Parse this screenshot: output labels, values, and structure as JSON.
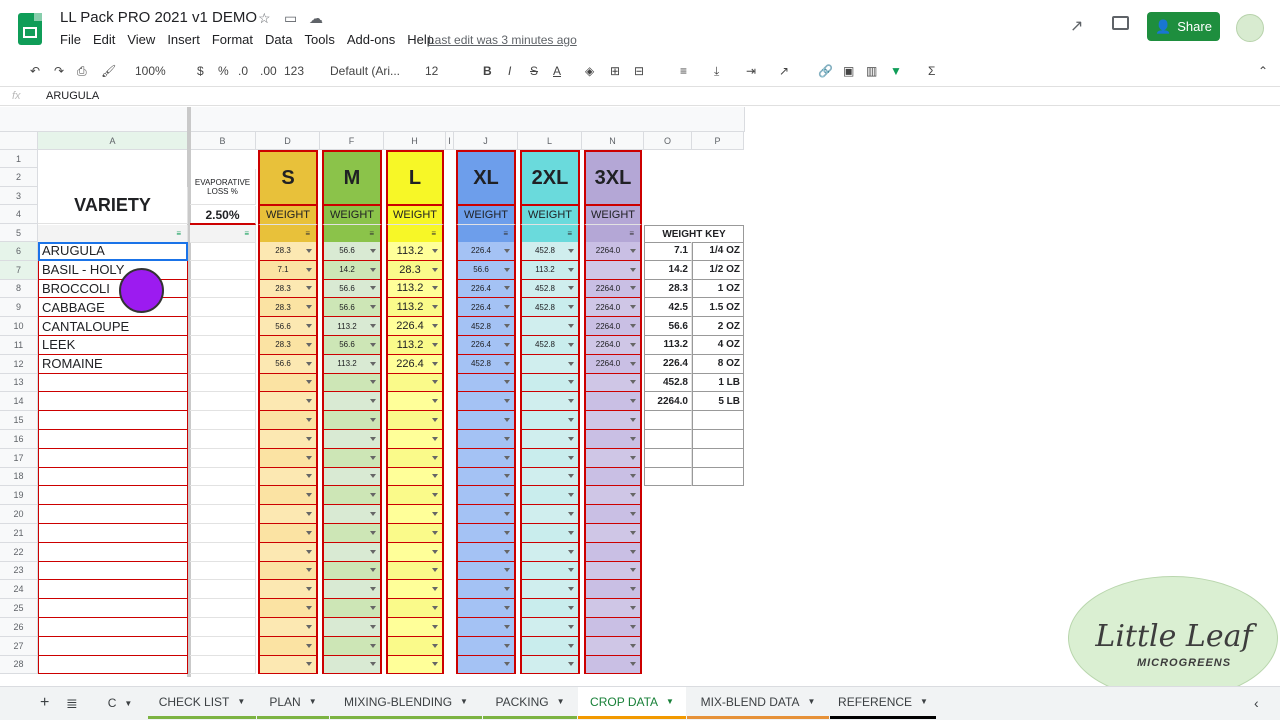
{
  "title": "LL Pack PRO 2021 v1 DEMO",
  "menu": [
    "File",
    "Edit",
    "View",
    "Insert",
    "Format",
    "Data",
    "Tools",
    "Add-ons",
    "Help"
  ],
  "last_edit": "Last edit was 3 minutes ago",
  "share": "Share",
  "toolbar": {
    "zoom": "100%",
    "currency": "$",
    "percent": "%",
    "dec_less": ".0",
    "dec_more": ".00",
    "number_format": "123",
    "font": "Default (Ari...",
    "size": "12"
  },
  "formula": {
    "fx": "fx",
    "ref": "ARUGULA"
  },
  "cols": [
    "A",
    "B",
    "D",
    "F",
    "H",
    "I",
    "J",
    "L",
    "N",
    "O",
    "P"
  ],
  "sizes": [
    {
      "label": "S",
      "sub": "WEIGHT",
      "color": "#e8c13a",
      "light": "#fbe3a3",
      "cell": "#fce8b2"
    },
    {
      "label": "M",
      "sub": "WEIGHT",
      "color": "#8bc34a",
      "light": "#cde6b6",
      "cell": "#d9ead3"
    },
    {
      "label": "L",
      "sub": "WEIGHT",
      "color": "#f7f727",
      "light": "#fafa8a",
      "cell": "#ffff99"
    },
    {
      "label": "XL",
      "sub": "WEIGHT",
      "color": "#6d9eeb",
      "light": "#a4c2f4",
      "cell": "#a4c2f4"
    },
    {
      "label": "2XL",
      "sub": "WEIGHT",
      "color": "#6adadc",
      "light": "#c9eded",
      "cell": "#d0eeee"
    },
    {
      "label": "3XL",
      "sub": "WEIGHT",
      "color": "#b4a7d6",
      "light": "#cfc6e6",
      "cell": "#c9bfe4"
    }
  ],
  "header": {
    "variety": "VARIETY",
    "evap": "EVAPORATIVE LOSS %",
    "evap_val": "2.50%"
  },
  "rows": [
    {
      "name": "ARUGULA",
      "v": [
        "28.3",
        "56.6",
        "113.2",
        "226.4",
        "452.8",
        "2264.0"
      ]
    },
    {
      "name": "BASIL - HOLY",
      "v": [
        "7.1",
        "14.2",
        "28.3",
        "56.6",
        "113.2",
        ""
      ]
    },
    {
      "name": "BROCCOLI",
      "v": [
        "28.3",
        "56.6",
        "113.2",
        "226.4",
        "452.8",
        "2264.0"
      ]
    },
    {
      "name": "CABBAGE",
      "v": [
        "28.3",
        "56.6",
        "113.2",
        "226.4",
        "452.8",
        "2264.0"
      ]
    },
    {
      "name": "CANTALOUPE",
      "v": [
        "56.6",
        "113.2",
        "226.4",
        "452.8",
        "",
        "2264.0"
      ]
    },
    {
      "name": "LEEK",
      "v": [
        "28.3",
        "56.6",
        "113.2",
        "226.4",
        "452.8",
        "2264.0"
      ]
    },
    {
      "name": "ROMAINE",
      "v": [
        "56.6",
        "113.2",
        "226.4",
        "452.8",
        "",
        "2264.0"
      ]
    }
  ],
  "weight_key": {
    "title": "WEIGHT KEY",
    "items": [
      [
        "7.1",
        "1/4 OZ"
      ],
      [
        "14.2",
        "1/2 OZ"
      ],
      [
        "28.3",
        "1 OZ"
      ],
      [
        "42.5",
        "1.5 OZ"
      ],
      [
        "56.6",
        "2 OZ"
      ],
      [
        "113.2",
        "4 OZ"
      ],
      [
        "226.4",
        "8 OZ"
      ],
      [
        "452.8",
        "1 LB"
      ],
      [
        "2264.0",
        "5 LB"
      ]
    ]
  },
  "tabs": [
    {
      "label": "C",
      "color": ""
    },
    {
      "label": "CHECK LIST",
      "color": "#7cb342"
    },
    {
      "label": "PLAN",
      "color": "#7cb342"
    },
    {
      "label": "MIXING-BLENDING",
      "color": "#7cb342"
    },
    {
      "label": "PACKING",
      "color": "#7cb342"
    },
    {
      "label": "CROP DATA",
      "color": "#f29900",
      "active": true
    },
    {
      "label": "MIX-BLEND DATA",
      "color": "#e69138"
    },
    {
      "label": "REFERENCE",
      "color": "#000000"
    }
  ],
  "logo": {
    "line1": "Little Leaf",
    "line2": "MICROGREENS"
  }
}
